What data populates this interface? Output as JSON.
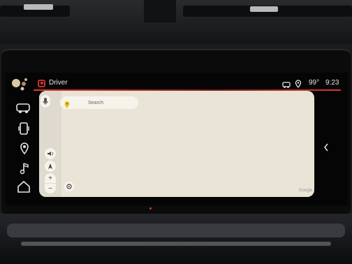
{
  "status_bar": {
    "profile_label": "Driver",
    "temperature": "99°",
    "time": "9:23"
  },
  "left_rail": {
    "items": [
      {
        "icon": "vehicle-icon"
      },
      {
        "icon": "phone-icon"
      },
      {
        "icon": "location-pin-icon"
      },
      {
        "icon": "music-icon"
      },
      {
        "icon": "home-icon"
      }
    ]
  },
  "map": {
    "search_placeholder": "Search",
    "attribution": "Google",
    "controls": {
      "zoom_in": "+",
      "zoom_out": "−"
    }
  },
  "colors": {
    "accent_red": "#e5352f",
    "map_bg": "#e9e4d6",
    "search_pin": "#f4c41f"
  }
}
